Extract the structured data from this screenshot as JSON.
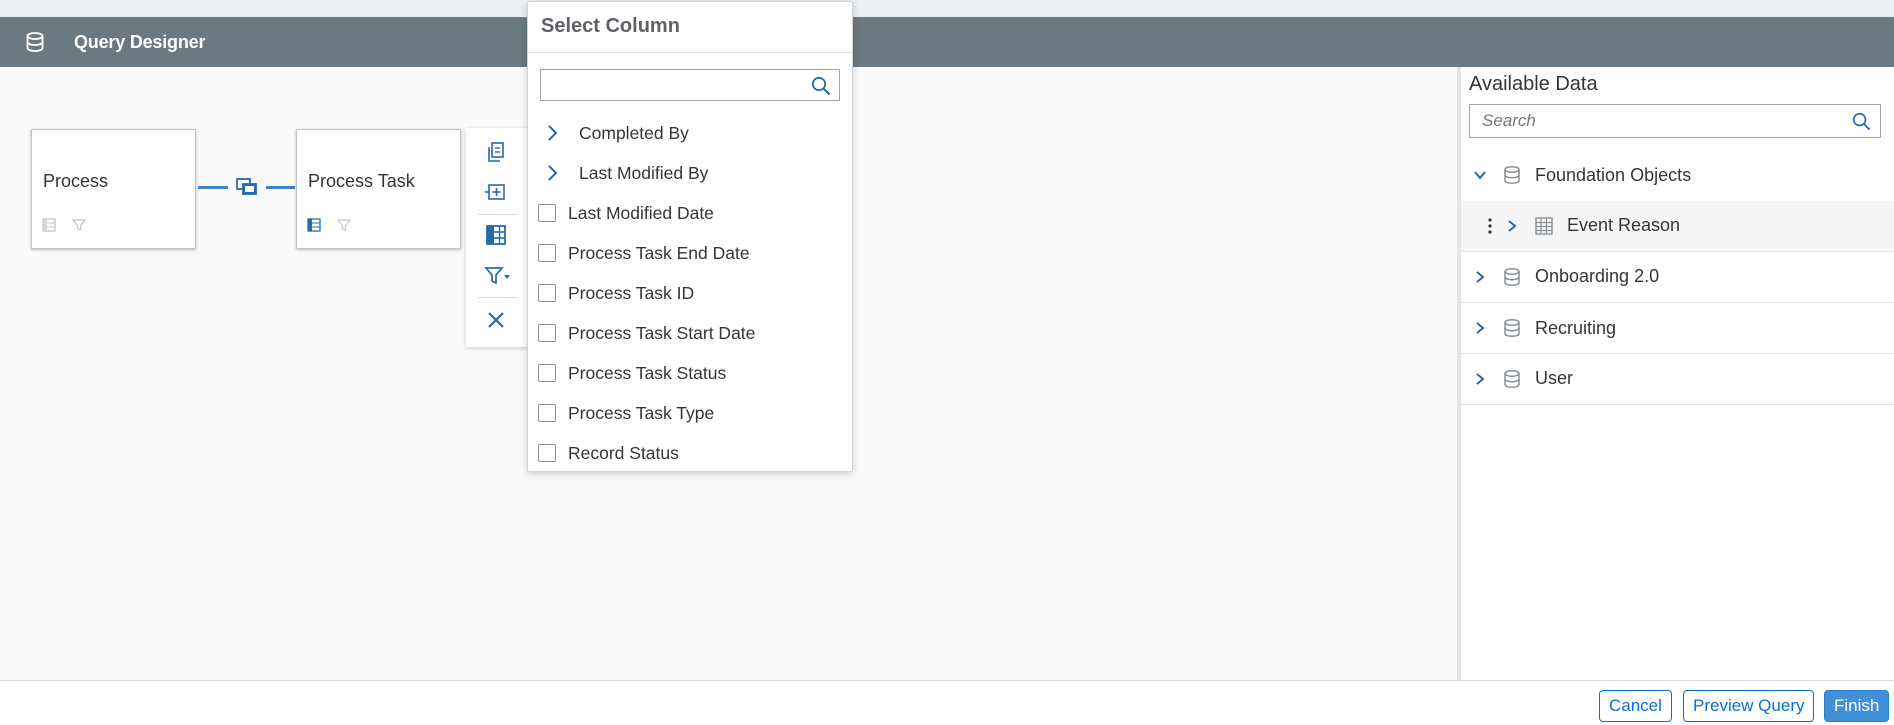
{
  "header": {
    "title": "Query Designer",
    "icon": "database-icon"
  },
  "canvas": {
    "nodes": [
      {
        "label": "Process"
      },
      {
        "label": "Process Task"
      }
    ],
    "connector_color": "#3f83c5"
  },
  "node_toolbar": {
    "buttons": [
      "copy-icon",
      "add-join-icon",
      "columns-icon",
      "filter-dropdown-icon",
      "close-icon"
    ]
  },
  "select_column": {
    "title": "Select Column",
    "search_value": "",
    "items": [
      {
        "label": "Completed By",
        "type": "expandable"
      },
      {
        "label": "Last Modified By",
        "type": "expandable"
      },
      {
        "label": "Last Modified Date",
        "type": "checkbox",
        "checked": false
      },
      {
        "label": "Process Task End Date",
        "type": "checkbox",
        "checked": false
      },
      {
        "label": "Process Task ID",
        "type": "checkbox",
        "checked": false
      },
      {
        "label": "Process Task Start Date",
        "type": "checkbox",
        "checked": false
      },
      {
        "label": "Process Task Status",
        "type": "checkbox",
        "checked": false
      },
      {
        "label": "Process Task Type",
        "type": "checkbox",
        "checked": false
      },
      {
        "label": "Record Status",
        "type": "checkbox",
        "checked": false
      }
    ]
  },
  "available_data": {
    "title": "Available Data",
    "search_placeholder": "Search",
    "tree": [
      {
        "label": "Foundation Objects",
        "expanded": true
      },
      {
        "label": "Event Reason",
        "child": true
      },
      {
        "label": "Onboarding 2.0",
        "expanded": false
      },
      {
        "label": "Recruiting",
        "expanded": false
      },
      {
        "label": "User",
        "expanded": false
      }
    ]
  },
  "footer": {
    "cancel": "Cancel",
    "preview": "Preview Query",
    "finish": "Finish"
  },
  "colors": {
    "header_bg": "#6b7a82",
    "accent": "#0a6ed1",
    "primary_button": "#3f8fd9"
  }
}
